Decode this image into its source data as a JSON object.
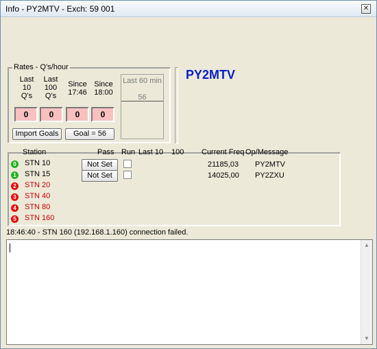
{
  "window": {
    "title": "Info - PY2MTV - Exch: 59 001",
    "close_symbol": "✕"
  },
  "rates": {
    "group_title": "Rates - Q's/hour",
    "col1": [
      "Last",
      "10",
      "Q's"
    ],
    "col2": [
      "Last",
      "100",
      "Q's"
    ],
    "col3": [
      "Since",
      "17:46"
    ],
    "col4": [
      "Since",
      "18:00"
    ],
    "values": [
      "0",
      "0",
      "0",
      "0"
    ],
    "last60_label": "Last 60 min",
    "last60_value": "56",
    "import_goals_label": "Import Goals",
    "goal_label": "Goal = 56"
  },
  "callsign": "PY2MTV",
  "stations": {
    "headers": {
      "station": "Station",
      "pass": "Pass",
      "run": "Run",
      "last10": "Last 10",
      "hundred": "100",
      "current_freq": "Current Freq",
      "op_message": "Op/Message"
    },
    "rows": [
      {
        "num": "0",
        "name": "STN 10",
        "color": "#22b222",
        "text_color": "#000000",
        "pass": "Not Set",
        "freq": "21185,03",
        "op": "PY2MTV"
      },
      {
        "num": "1",
        "name": "STN 15",
        "color": "#22b222",
        "text_color": "#000000",
        "pass": "Not Set",
        "freq": "14025,00",
        "op": "PY2ZXU"
      },
      {
        "num": "2",
        "name": "STN 20",
        "color": "#e01010",
        "text_color": "#cc0000"
      },
      {
        "num": "3",
        "name": "STN 40",
        "color": "#e01010",
        "text_color": "#cc0000"
      },
      {
        "num": "4",
        "name": "STN 80",
        "color": "#e01010",
        "text_color": "#cc0000"
      },
      {
        "num": "5",
        "name": "STN 160",
        "color": "#e01010",
        "text_color": "#cc0000"
      }
    ]
  },
  "status_message": "18:46:40 - STN 160 (192.168.1.160) connection failed.",
  "scroll_up": "▲",
  "scroll_down": "▼"
}
